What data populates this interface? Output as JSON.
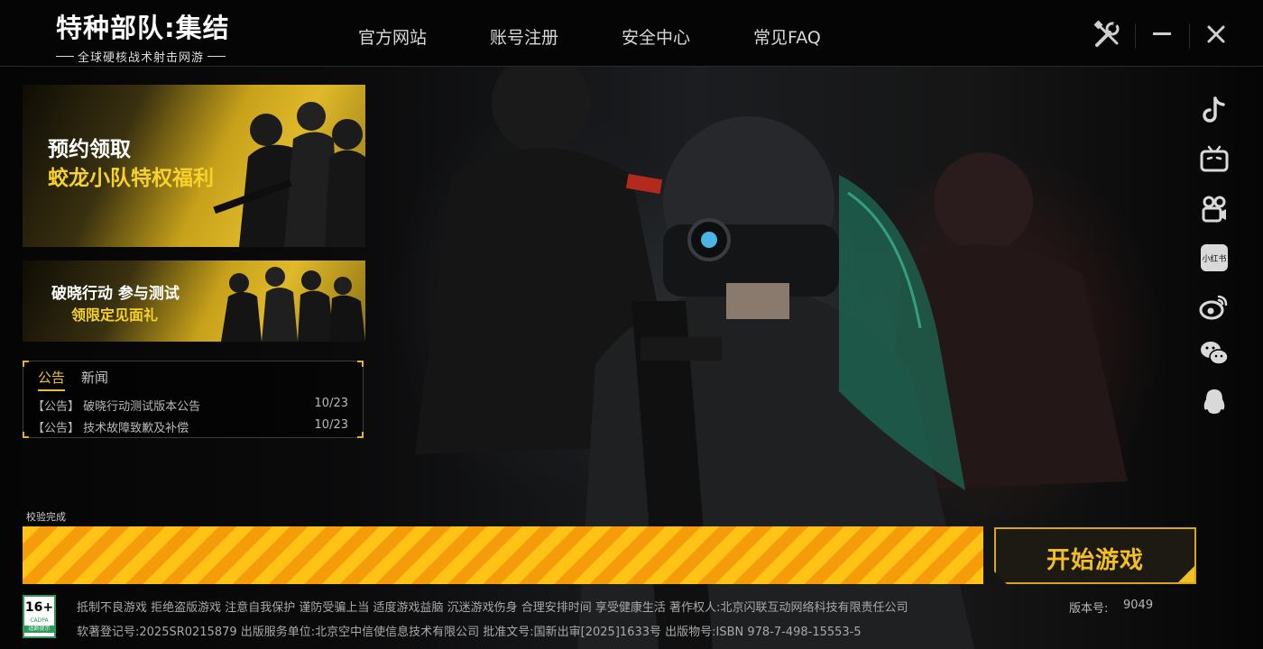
{
  "logo": {
    "title": "特种部队:集结",
    "subtitle": "全球硬核战术射击网游"
  },
  "nav": [
    "官方网站",
    "账号注册",
    "安全中心",
    "常见FAQ"
  ],
  "window_controls": {
    "settings_icon": "wrench-screwdriver-icon",
    "minimize_icon": "minimize-icon",
    "close_icon": "close-icon"
  },
  "banners": [
    {
      "line1": "预约领取",
      "line2": "蛟龙小队特权福利"
    },
    {
      "line1": "破晓行动 参与测试",
      "line2": "领限定见面礼"
    }
  ],
  "news": {
    "tabs": [
      "公告",
      "新闻"
    ],
    "active_tab": "公告",
    "items": [
      {
        "title": "【公告】 破晓行动测试版本公告",
        "date": "10/23"
      },
      {
        "title": "【公告】 技术故障致歉及补偿",
        "date": "10/23"
      }
    ]
  },
  "social_icons": [
    "douyin-icon",
    "bilibili-icon",
    "kuaishou-icon",
    "xiaohongshu-icon",
    "weibo-icon",
    "wechat-icon",
    "qq-icon"
  ],
  "xiaohongshu_text": "小红书",
  "progress": {
    "status": "校验完成",
    "fraction": 1.0
  },
  "start_button": {
    "label": "开始游戏"
  },
  "age_rating": {
    "age": "16+",
    "org": "CADPA",
    "hint": "适龄提示"
  },
  "footer": {
    "line1": "抵制不良游戏 拒绝盗版游戏 注意自我保护 谨防受骗上当 适度游戏益脑 沉迷游戏伤身 合理安排时间 享受健康生活 著作权人:北京闪联互动网络科技有限责任公司",
    "line2": "软著登记号:2025SR0215879 出版服务单位:北京空中信使信息技术有限公司 批准文号:国新出审[2025]1633号 出版物号:ISBN 978-7-498-15553-5",
    "version_label": "版本号:",
    "version": "9049"
  },
  "colors": {
    "accent": "#f3bf23",
    "progress": "#f5a716",
    "background": "#000000"
  }
}
